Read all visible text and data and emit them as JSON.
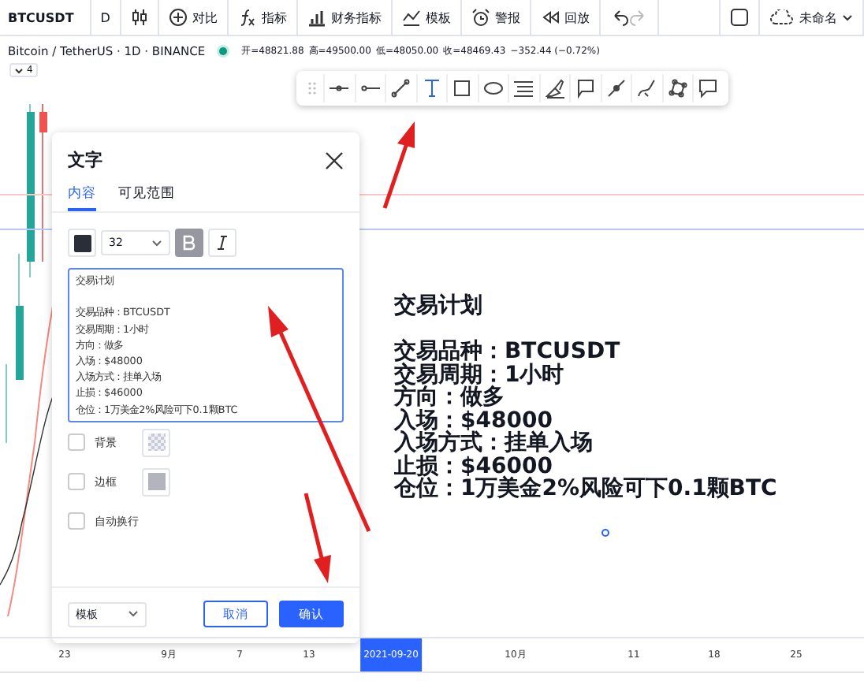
{
  "top_toolbar": {
    "symbol": "BTCUSDT",
    "interval": "D",
    "items": [
      {
        "kind": "candles"
      },
      {
        "kind": "plus",
        "label": "对比"
      },
      {
        "kind": "fx",
        "label": "指标"
      },
      {
        "kind": "bars",
        "label": "财务指标"
      },
      {
        "kind": "wave",
        "label": "模板"
      },
      {
        "kind": "alarm",
        "label": "警报"
      },
      {
        "kind": "rewind",
        "label": "回放"
      },
      {
        "kind": "undo"
      }
    ],
    "layout_name": "未命名"
  },
  "legend": {
    "title": "Bitcoin / TetherUS · 1D · BINANCE",
    "values": [
      "开=48821.88",
      "高=49500.00",
      "低=48050.00",
      "收=48469.43",
      "−352.44 (−0.72%)"
    ],
    "collapse": "4"
  },
  "drawing_toolbar": [
    {
      "kind": "hline",
      "selected": false
    },
    {
      "kind": "ray",
      "selected": false
    },
    {
      "kind": "line",
      "selected": false
    },
    {
      "kind": "text",
      "selected": true
    },
    {
      "kind": "rect",
      "selected": false
    },
    {
      "kind": "ellipse",
      "selected": false
    },
    {
      "kind": "lines",
      "selected": false
    },
    {
      "kind": "brush",
      "selected": false
    },
    {
      "kind": "callout",
      "selected": false
    },
    {
      "kind": "pen",
      "selected": false
    },
    {
      "kind": "curve",
      "selected": false
    },
    {
      "kind": "shape",
      "selected": false
    },
    {
      "kind": "comment",
      "selected": false
    }
  ],
  "dialog": {
    "title": "文字",
    "tabs": [
      {
        "label": "内容",
        "selected": true
      },
      {
        "label": "可见范围",
        "selected": false
      }
    ],
    "color": "#2a2e39",
    "font_size": "32",
    "bold": true,
    "italic": false,
    "text_title": "交易计划",
    "text_lines": [
      "交易品种：BTCUSDT",
      "交易周期：1小时",
      "方向：做多",
      "入场：$48000",
      "入场方式：挂单入场",
      "止损：$46000",
      "仓位：1万美金2%风险可下0.1颗BTC"
    ],
    "options": [
      {
        "label": "背景",
        "checked": false,
        "kind": "pattern"
      },
      {
        "label": "边框",
        "checked": false,
        "kind": "swatch"
      },
      {
        "label": "自动换行",
        "checked": false,
        "kind": "none"
      }
    ],
    "template": "模板",
    "cancel": "取消",
    "confirm": "确认"
  },
  "chart_text": {
    "title": "交易计划",
    "lines": [
      "交易品种：BTCUSDT",
      "交易周期：1小时",
      "方向：做多",
      "入场：$48000",
      "入场方式：挂单入场",
      "止损：$46000",
      "仓位：1万美金2%风险可下0.1颗BTC"
    ]
  },
  "time_axis": [
    {
      "label": "23",
      "selected": false
    },
    {
      "label": "9月",
      "selected": false
    },
    {
      "label": "7",
      "selected": false
    },
    {
      "label": "13",
      "selected": false
    },
    {
      "label": "2021-09-20",
      "selected": true
    },
    {
      "label": "10月",
      "selected": false
    },
    {
      "label": "11",
      "selected": false
    },
    {
      "label": "18",
      "selected": false
    },
    {
      "label": "25",
      "selected": false
    }
  ]
}
